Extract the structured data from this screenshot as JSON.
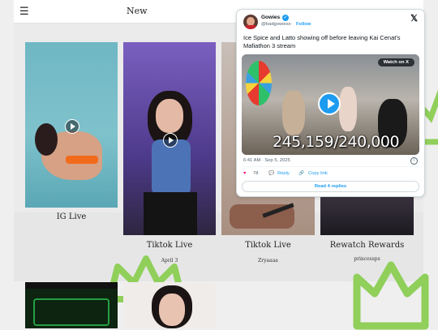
{
  "header": {
    "menu_icon": "hamburger-menu-icon",
    "title": "New"
  },
  "grid": {
    "items": [
      {
        "caption": "IG Live",
        "sub": ""
      },
      {
        "caption": "Tiktok Live",
        "sub": "April 3"
      },
      {
        "caption": "Tiktok Live",
        "sub": "Zryaaaa"
      },
      {
        "caption": "Rewatch Rewards",
        "sub": "princessps"
      }
    ]
  },
  "tweet": {
    "author_name": "Gowies",
    "handle": "@badgowiesx",
    "follow_label": "Follow",
    "separator": "·",
    "text": "Ice Spice and Latto showing off before leaving Kai Cenat's Mafiathon 3 stream",
    "video": {
      "watch_label": "Watch on X",
      "overlay_counter": "245,159/240,000"
    },
    "time": "6:41 AM · Sep 5, 2025",
    "likes": "78",
    "reply_label": "Reply",
    "copy_link_label": "Copy link",
    "read_replies_label": "Read 4 replies"
  },
  "colors": {
    "accent": "#1d9bf0",
    "crown_green": "#8fcf5a",
    "like": "#f91880"
  }
}
